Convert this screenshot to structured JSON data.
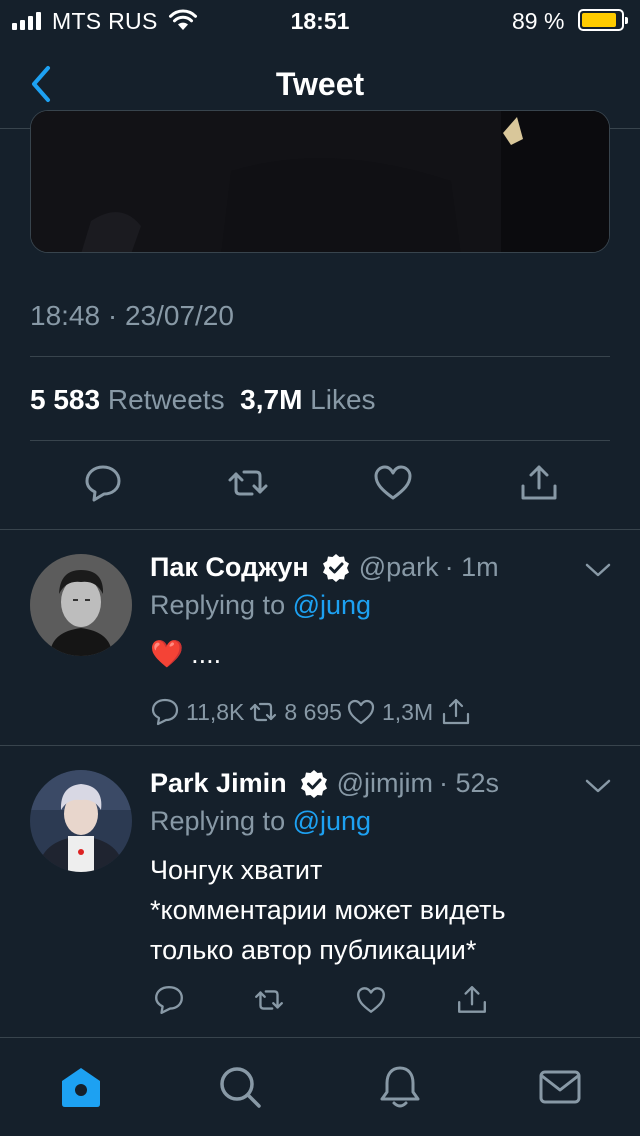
{
  "status_bar": {
    "carrier": "MTS RUS",
    "time": "18:51",
    "battery_percent": "89 %",
    "battery_level": 0.89,
    "battery_color": "#ffcc00"
  },
  "nav": {
    "title": "Tweet"
  },
  "tweet": {
    "timestamp": "18:48 · 23/07/20",
    "retweets_count": "5 583",
    "retweets_label": "Retweets",
    "likes_count": "3,7M",
    "likes_label": "Likes"
  },
  "replies": [
    {
      "name": "Пак Соджун",
      "handle": "@park",
      "time": "· 1m",
      "replying_prefix": "Replying to",
      "replying_to": "@jung",
      "text_lines": [
        "❤️ ...."
      ],
      "reply_count": "11,8K",
      "retweet_count": "8 695",
      "like_count": "1,3M"
    },
    {
      "name": "Park Jimin",
      "handle": "@jimjim",
      "time": "· 52s",
      "replying_prefix": "Replying to",
      "replying_to": "@jung",
      "text_lines": [
        "Чонгук хватит",
        "*комментарии может видеть",
        "только автор публикации*"
      ]
    }
  ],
  "colors": {
    "background": "#15202b",
    "accent": "#1da1f2",
    "secondary_text": "#8899a6",
    "divider": "#38444d"
  },
  "icons": {
    "tab_home": "home-icon",
    "tab_search": "search-icon",
    "tab_notifications": "bell-icon",
    "tab_messages": "mail-icon"
  }
}
